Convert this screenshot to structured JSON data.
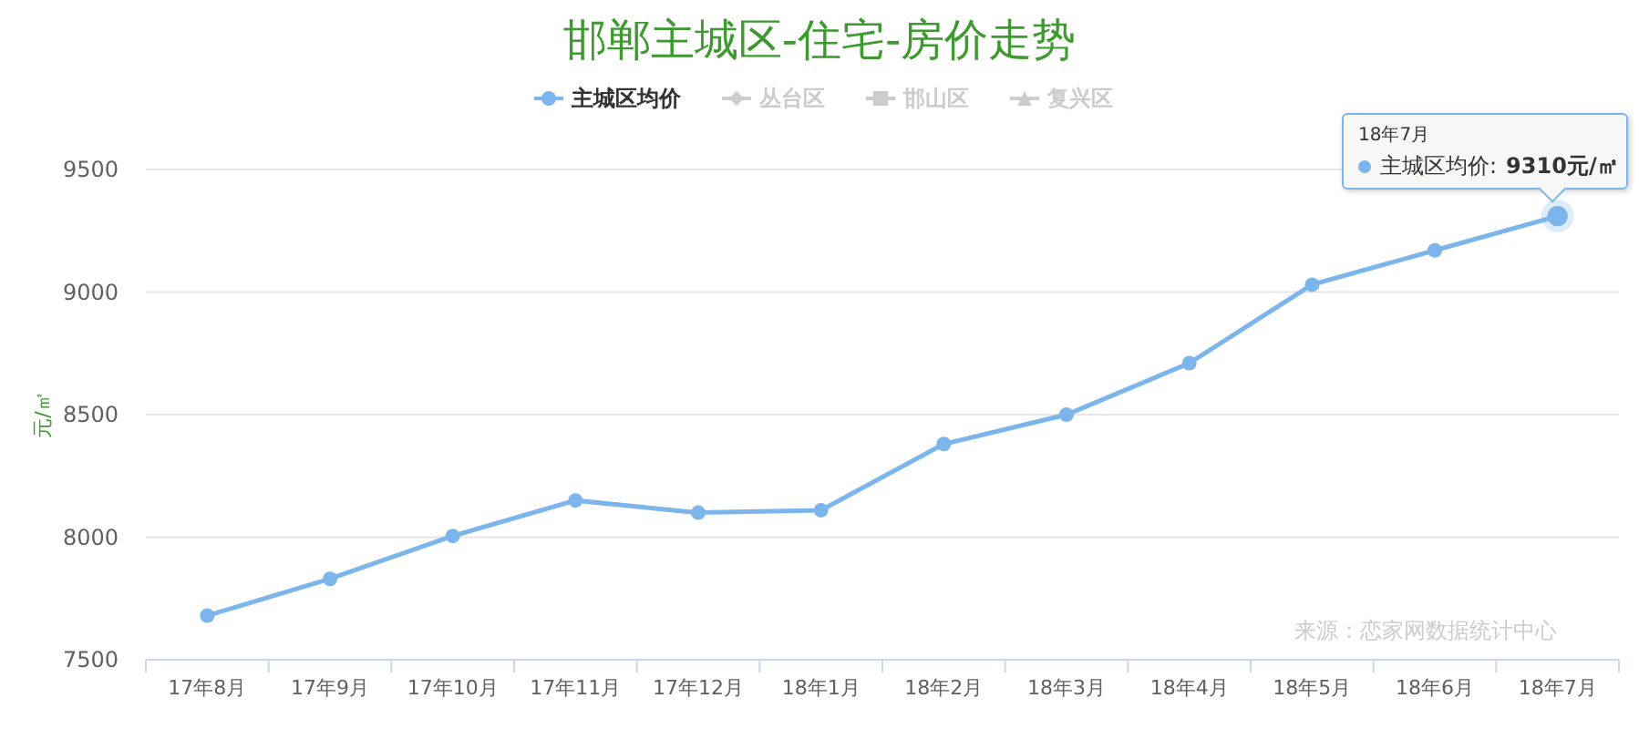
{
  "title": "邯郸主城区-住宅-房价走势",
  "legend": [
    {
      "label": "主城区均价",
      "kind": "circle",
      "selected": true
    },
    {
      "label": "丛台区",
      "kind": "diamond",
      "selected": false
    },
    {
      "label": "邯山区",
      "kind": "square",
      "selected": false
    },
    {
      "label": "复兴区",
      "kind": "triangle",
      "selected": false
    }
  ],
  "chart_data": {
    "type": "line",
    "ylabel": "元/㎡",
    "categories": [
      "17年8月",
      "17年9月",
      "17年10月",
      "17年11月",
      "17年12月",
      "18年1月",
      "18年2月",
      "18年3月",
      "18年4月",
      "18年5月",
      "18年6月",
      "18年7月"
    ],
    "grid": true,
    "series": [
      {
        "name": "主城区均价",
        "color": "#7cb5ec",
        "marker": "circle",
        "values": [
          7680,
          7830,
          8005,
          8150,
          8100,
          8110,
          8380,
          8500,
          8710,
          9030,
          9170,
          9310
        ]
      }
    ],
    "ylim": [
      7500,
      9500
    ],
    "yticks": [
      7500,
      8000,
      8500,
      9000,
      9500
    ]
  },
  "source": "来源：恋家网数据统计中心",
  "tooltip": {
    "title": "18年7月",
    "separator": ":",
    "value": "9310元/㎡"
  }
}
